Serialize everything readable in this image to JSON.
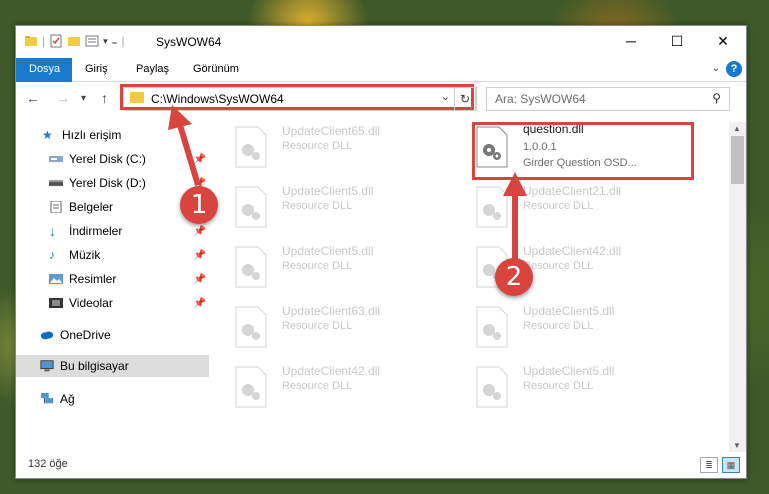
{
  "window": {
    "title": "SysWOW64",
    "buttons": {
      "minimize": "─",
      "maximize": "☐",
      "close": "✕"
    }
  },
  "ribbon": {
    "tabs": [
      "Dosya",
      "Giriş",
      "Paylaş",
      "Görünüm"
    ],
    "help": "?"
  },
  "nav": {
    "back": "←",
    "forward": "→",
    "recent": "▾",
    "up": "↑",
    "address": "C:\\Windows\\SysWOW64",
    "refresh": "↻",
    "search_placeholder": "Ara: SysWOW64"
  },
  "sidebar": {
    "items": [
      {
        "label": "Hızlı erişim",
        "icon": "star-icon",
        "pinned": false
      },
      {
        "label": "Yerel Disk (C:)",
        "icon": "drive-icon",
        "pinned": true
      },
      {
        "label": "Yerel Disk (D:)",
        "icon": "drive-icon",
        "pinned": true
      },
      {
        "label": "Belgeler",
        "icon": "documents-icon",
        "pinned": true
      },
      {
        "label": "İndirmeler",
        "icon": "downloads-icon",
        "pinned": true
      },
      {
        "label": "Müzik",
        "icon": "music-icon",
        "pinned": true
      },
      {
        "label": "Resimler",
        "icon": "pictures-icon",
        "pinned": true
      },
      {
        "label": "Videolar",
        "icon": "videos-icon",
        "pinned": true
      },
      {
        "label": "OneDrive",
        "icon": "cloud-icon",
        "pinned": false
      },
      {
        "label": "Bu bilgisayar",
        "icon": "computer-icon",
        "pinned": false
      },
      {
        "label": "Ağ",
        "icon": "network-icon",
        "pinned": false
      }
    ]
  },
  "files": {
    "left": [
      {
        "name": "UpdateClient65.dll",
        "type": "Resource DLL"
      },
      {
        "name": "UpdateClient5.dll",
        "type": "Resource DLL"
      },
      {
        "name": "UpdateClient5.dll",
        "type": "Resource DLL"
      },
      {
        "name": "UpdateClient63.dll",
        "type": "Resource DLL"
      },
      {
        "name": "UpdateClient42.dll",
        "type": "Resource DLL"
      }
    ],
    "right": [
      {
        "name": "question.dll",
        "version": "1.0.0.1",
        "description": "Girder Question OSD..."
      },
      {
        "name": "UpdateClient21.dll",
        "type": "Resource DLL"
      },
      {
        "name": "UpdateClient42.dll",
        "type": "Resource DLL"
      },
      {
        "name": "UpdateClient5.dll",
        "type": "Resource DLL"
      },
      {
        "name": "UpdateClient5.dll",
        "type": "Resource DLL"
      }
    ]
  },
  "status": {
    "count": "132 öğe"
  },
  "callouts": [
    "1",
    "2"
  ],
  "colors": {
    "accent": "#1979ca",
    "highlight": "#d9443f",
    "folder": "#f3c94c"
  }
}
